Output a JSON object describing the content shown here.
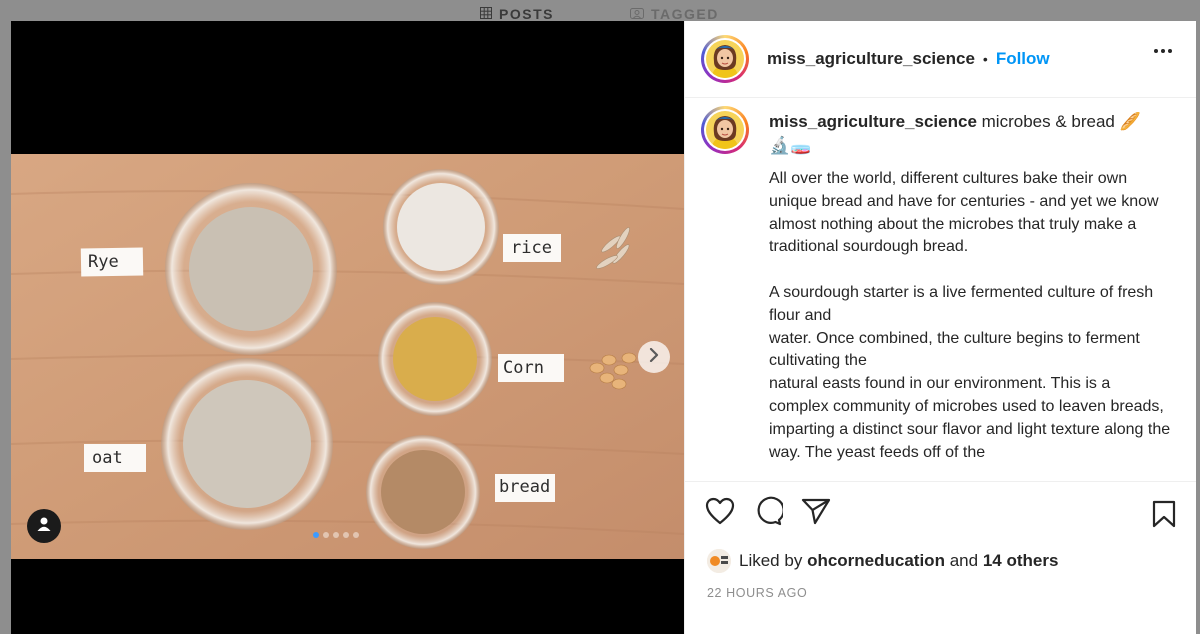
{
  "background_tabs": [
    {
      "label": "POSTS",
      "icon": "grid-icon"
    },
    {
      "label": "TAGGED",
      "icon": "tagged-icon"
    }
  ],
  "photo": {
    "labels": {
      "rye": "Rye",
      "rice": "rice",
      "corn": "Corn",
      "oat": "oat",
      "bread": "bread"
    }
  },
  "carousel": {
    "slides": 5,
    "active_index": 0
  },
  "post_header": {
    "username": "miss_agriculture_science",
    "separator": "•",
    "follow_label": "Follow"
  },
  "caption": {
    "username": "miss_agriculture_science",
    "title": "microbes & bread 🥖",
    "title_emojis": "🔬🧫",
    "body": "All over the world, different cultures bake their own unique bread and have for centuries - and yet we know almost nothing about the microbes that truly make a traditional sourdough bread.\n\nA sourdough starter is a live fermented culture of fresh flour and\nwater. Once combined, the culture begins to ferment cultivating the\nnatural easts found in our environment. This is a complex community of microbes used to leaven breads, imparting a distinct sour flavor and light texture along the way. The yeast feeds off of the"
  },
  "likes": {
    "prefix": "Liked by",
    "user": "ohcorneducation",
    "conjunction": "and",
    "others": "14 others"
  },
  "timestamp": "22 HOURS AGO",
  "colors": {
    "follow": "#0095f6",
    "text": "#262626",
    "muted": "#8e8e8e"
  }
}
